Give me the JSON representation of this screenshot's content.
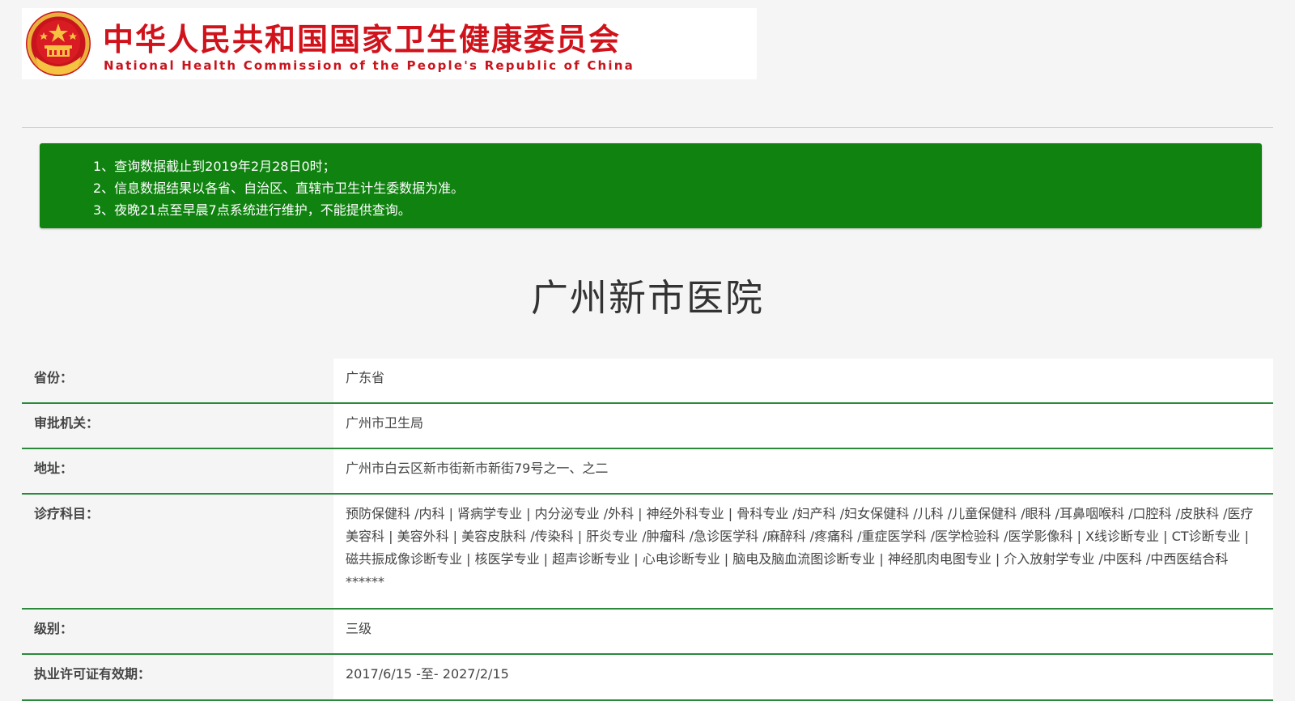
{
  "header": {
    "site_name_cn": "中华人民共和国国家卫生健康委员会",
    "site_name_en": "National Health Commission of the People's Republic of China",
    "emblem_icon": "national-emblem-icon",
    "brand_color": "#d0121b"
  },
  "notice": {
    "background_color": "#0f820f",
    "items": [
      "1、查询数据截止到2019年2月28日0时；",
      "2、信息数据结果以各省、自治区、直辖市卫生计生委数据为准。",
      "3、夜晚21点至早晨7点系统进行维护，不能提供查询。"
    ]
  },
  "hospital": {
    "name": "广州新市医院"
  },
  "details": {
    "divider_color": "#2a8a3c",
    "rows": [
      {
        "label": "省份：",
        "value": "广东省"
      },
      {
        "label": "审批机关：",
        "value": "广州市卫生局"
      },
      {
        "label": "地址：",
        "value": "广州市白云区新市街新市新街79号之一、之二"
      },
      {
        "label": "诊疗科目：",
        "value": "预防保健科 /内科 | 肾病学专业 | 内分泌专业 /外科 | 神经外科专业 | 骨科专业 /妇产科 /妇女保健科 /儿科 /儿童保健科 /眼科 /耳鼻咽喉科 /口腔科 /皮肤科 /医疗美容科 | 美容外科 | 美容皮肤科 /传染科 | 肝炎专业 /肿瘤科 /急诊医学科 /麻醉科 /疼痛科 /重症医学科 /医学检验科 /医学影像科 | X线诊断专业 | CT诊断专业 | 磁共振成像诊断专业 | 核医学专业 | 超声诊断专业 | 心电诊断专业 | 脑电及脑血流图诊断专业 | 神经肌肉电图专业 | 介入放射学专业 /中医科 /中西医结合科******"
      },
      {
        "label": "级别：",
        "value": "三级"
      },
      {
        "label": "执业许可证有效期：",
        "value": "2017/6/15 -至- 2027/2/15"
      }
    ]
  }
}
